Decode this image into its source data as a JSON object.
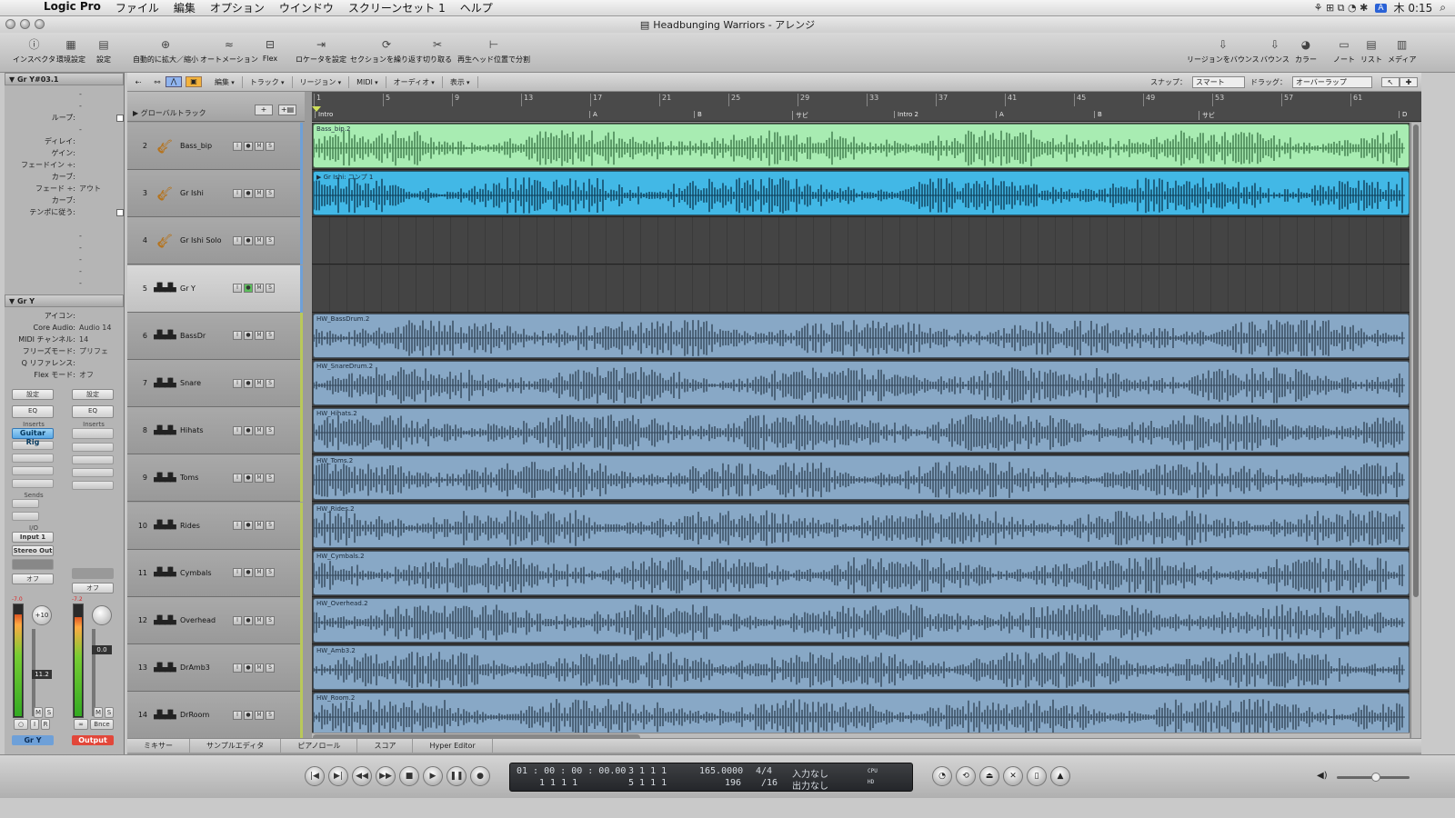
{
  "menubar": {
    "items": [
      "Logic Pro",
      "ファイル",
      "編集",
      "オプション",
      "ウインドウ",
      "スクリーンセット 1",
      "ヘルプ"
    ],
    "clock": "木 0:15"
  },
  "window": {
    "title": "Headbunging Warriors - アレンジ"
  },
  "toolbar": {
    "left": [
      "インスペクタ",
      "環境設定",
      "設定",
      "自動的に拡大／縮小",
      "オートメーション",
      "Flex",
      "ロケータを設定",
      "セクションを繰り返す",
      "切り取る",
      "再生ヘッド位置で分割"
    ],
    "right": [
      "リージョンをバウンス",
      "バウンス",
      "カラー",
      "ノート",
      "リスト",
      "メディア"
    ]
  },
  "inspector": {
    "region_header": "Gr Y#03.1",
    "region_params": [
      {
        "k": "",
        "v": "-"
      },
      {
        "k": "",
        "v": "-"
      },
      {
        "k": "ループ:",
        "v": "",
        "chk": true
      },
      {
        "k": "",
        "v": "-"
      },
      {
        "k": "ディレイ:",
        "v": ""
      },
      {
        "k": "ゲイン:",
        "v": ""
      },
      {
        "k": "フェードイン ÷:",
        "v": ""
      },
      {
        "k": "カーブ:",
        "v": ""
      },
      {
        "k": "フェード ÷:",
        "v": "アウト"
      },
      {
        "k": "カーブ:",
        "v": ""
      },
      {
        "k": "テンポに従う:",
        "v": "",
        "chk": true
      },
      {
        "k": "",
        "v": ""
      },
      {
        "k": "",
        "v": "-"
      },
      {
        "k": "",
        "v": "-"
      },
      {
        "k": "",
        "v": "-"
      },
      {
        "k": "",
        "v": "-"
      },
      {
        "k": "",
        "v": "-"
      }
    ],
    "track_header": "Gr Y",
    "track_params": [
      {
        "k": "アイコン:",
        "v": ""
      },
      {
        "k": "Core Audio:",
        "v": "Audio 14"
      },
      {
        "k": "MIDI チャンネル:",
        "v": "14"
      },
      {
        "k": "フリーズモード:",
        "v": "プリフェ"
      },
      {
        "k": "Q リファレンス:",
        "v": ""
      },
      {
        "k": "Flex モード:",
        "v": "オフ"
      }
    ],
    "strip1": {
      "settings": "設定",
      "eq": "EQ",
      "inserts": "Inserts",
      "plugin": "Guitar Rig",
      "sends": "Sends",
      "io": "I/O",
      "input": "Input 1",
      "output": "Stereo Out",
      "auto": "オフ",
      "pan": "+10",
      "vol": "11.2",
      "name": "Gr Y",
      "meter": "-7.0"
    },
    "strip2": {
      "settings": "設定",
      "eq": "EQ",
      "inserts": "Inserts",
      "auto": "オフ",
      "vol": "0.0",
      "bnce": "Bnce",
      "name": "Output",
      "meter": "-7.2"
    }
  },
  "arrange": {
    "local_menus": [
      "編集",
      "トラック",
      "リージョン",
      "MIDI",
      "オーディオ",
      "表示"
    ],
    "snap_label": "スナップ：",
    "snap_value": "スマート",
    "drag_label": "ドラッグ：",
    "drag_value": "オーバーラップ",
    "global_tracks": "グローバルトラック",
    "bars": [
      "1",
      "5",
      "9",
      "13",
      "17",
      "21",
      "25",
      "29",
      "33",
      "37",
      "41",
      "45",
      "49",
      "53",
      "57",
      "61"
    ],
    "markers": [
      "Intro",
      "A",
      "B",
      "サビ",
      "Intro 2",
      "A",
      "B",
      "サビ",
      "D"
    ],
    "tracks": [
      {
        "num": "2",
        "name": "Bass_bip",
        "icon": "guitar",
        "region": "Bass_bip.2",
        "color": "#a8ecb2",
        "wave": "#3d7a4a",
        "bar": "#6ea0d8"
      },
      {
        "num": "3",
        "name": "Gr Ishi",
        "icon": "guitar",
        "region": "▶ Gr Ishi: コンプ 1",
        "color": "#42b8e6",
        "wave": "#0f3e58",
        "bar": "#6ea0d8"
      },
      {
        "num": "4",
        "name": "Gr Ishi Solo",
        "icon": "guitar",
        "region": "",
        "color": "",
        "wave": "",
        "bar": "#6ea0d8"
      },
      {
        "num": "5",
        "name": "Gr Y",
        "icon": "wave",
        "region": "",
        "color": "",
        "wave": "",
        "bar": "#6ea0d8",
        "selected": true
      },
      {
        "num": "6",
        "name": "BassDr",
        "icon": "wave",
        "region": "HW_BassDrum.2",
        "color": "#88a8c6",
        "wave": "#34475a",
        "bar": "#b9c95a"
      },
      {
        "num": "7",
        "name": "Snare",
        "icon": "wave",
        "region": "HW_SnareDrum.2",
        "color": "#88a8c6",
        "wave": "#34475a",
        "bar": "#b9c95a"
      },
      {
        "num": "8",
        "name": "Hihats",
        "icon": "wave",
        "region": "HW_Hihats.2",
        "color": "#88a8c6",
        "wave": "#34475a",
        "bar": "#b9c95a"
      },
      {
        "num": "9",
        "name": "Toms",
        "icon": "wave",
        "region": "HW_Toms.2",
        "color": "#88a8c6",
        "wave": "#34475a",
        "bar": "#b9c95a"
      },
      {
        "num": "10",
        "name": "Rides",
        "icon": "wave",
        "region": "HW_Rides.2",
        "color": "#88a8c6",
        "wave": "#34475a",
        "bar": "#b9c95a"
      },
      {
        "num": "11",
        "name": "Cymbals",
        "icon": "wave",
        "region": "HW_Cymbals.2",
        "color": "#88a8c6",
        "wave": "#34475a",
        "bar": "#b9c95a"
      },
      {
        "num": "12",
        "name": "Overhead",
        "icon": "wave",
        "region": "HW_Overhead.2",
        "color": "#88a8c6",
        "wave": "#34475a",
        "bar": "#b9c95a"
      },
      {
        "num": "13",
        "name": "DrAmb3",
        "icon": "wave",
        "region": "HW_Amb3.2",
        "color": "#88a8c6",
        "wave": "#34475a",
        "bar": "#b9c95a"
      },
      {
        "num": "14",
        "name": "DrRoom",
        "icon": "wave",
        "region": "HW_Room.2",
        "color": "#88a8c6",
        "wave": "#34475a",
        "bar": "#b9c95a"
      }
    ]
  },
  "bottom_tabs": [
    "ミキサー",
    "サンプルエディタ",
    "ピアノロール",
    "スコア",
    "Hyper Editor"
  ],
  "transport": {
    "smpte": "01 : 00 : 00 : 00.00",
    "smpte2": "1   1   1   1",
    "pos": "3   1   1   1",
    "pos2": "5   1   1   1",
    "tempo": "165.0000",
    "tempo2": "196",
    "sig": "4/4",
    "div": "/16",
    "in": "入力なし",
    "out": "出力なし",
    "cpu": "CPU",
    "hd": "HD"
  }
}
